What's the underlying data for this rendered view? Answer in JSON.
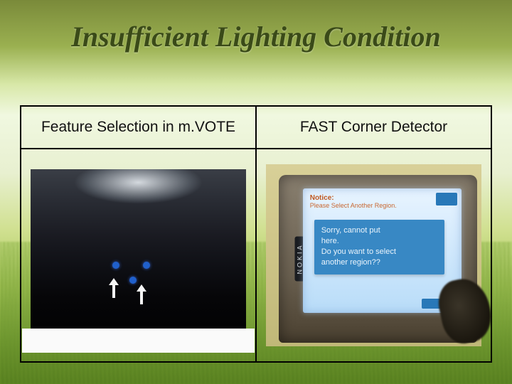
{
  "slide": {
    "title": "Insufficient Lighting Condition",
    "columns": [
      {
        "heading": "Feature Selection in m.VOTE"
      },
      {
        "heading": "FAST Corner Detector"
      }
    ]
  },
  "phone": {
    "brand": "NOKIA",
    "notice_title": "Notice:",
    "notice_sub": "Please Select Another Region.",
    "dialog_line1": "Sorry, cannot put",
    "dialog_line2": "here.",
    "dialog_line3": "Do you want to select",
    "dialog_line4": "another region??"
  }
}
